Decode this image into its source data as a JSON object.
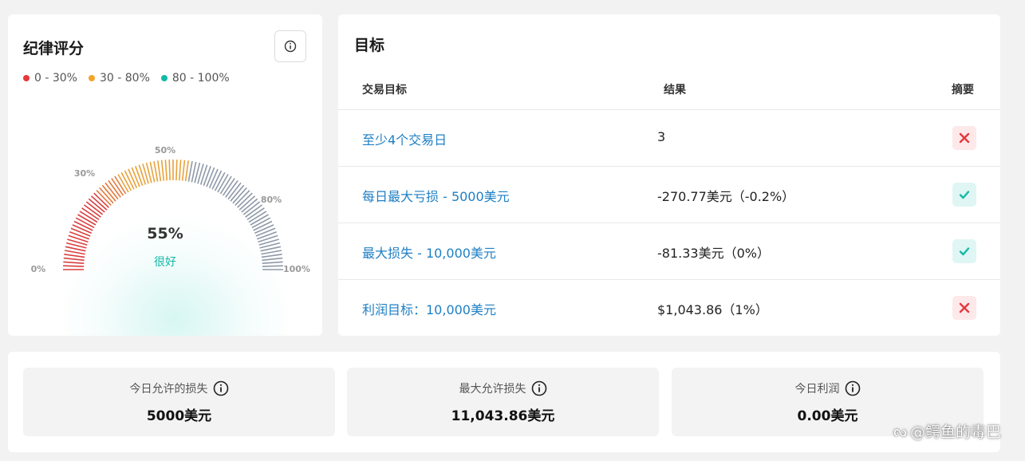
{
  "discipline": {
    "title": "纪律评分",
    "legend": [
      {
        "label": "0 - 30%",
        "color": "#e5383b"
      },
      {
        "label": "30 - 80%",
        "color": "#f4a42a"
      },
      {
        "label": "80 - 100%",
        "color": "#14b8a6"
      }
    ],
    "gauge": {
      "value_percent": 55,
      "value_label": "55%",
      "status": "很好",
      "tick_labels": [
        "0%",
        "30%",
        "50%",
        "80%",
        "100%"
      ],
      "segment_colors": {
        "low": "#d94040",
        "mid": "#e8a23a",
        "rest": "#8e99a8"
      }
    },
    "info_icon": "info-icon"
  },
  "goals": {
    "title": "目标",
    "headers": {
      "goal": "交易目标",
      "result": "结果",
      "summary": "摘要"
    },
    "rows": [
      {
        "goal": "至少4个交易日",
        "result": "3",
        "status": "fail"
      },
      {
        "goal": "每日最大亏损 - 5000美元",
        "result": "-270.77美元（-0.2%）",
        "status": "pass"
      },
      {
        "goal": "最大损失 - 10,000美元",
        "result": "-81.33美元（0%）",
        "status": "pass"
      },
      {
        "goal": "利润目标：10,000美元",
        "result": "$1,043.86（1%）",
        "status": "fail"
      }
    ]
  },
  "stats": [
    {
      "label": "今日允许的损失",
      "value": "5000美元"
    },
    {
      "label": "最大允许损失",
      "value": "11,043.86美元"
    },
    {
      "label": "今日利润",
      "value": "0.00美元"
    }
  ],
  "watermark": "@鳄鱼的毒巴",
  "colors": {
    "link": "#1e7fc4",
    "fail": "#e5383b",
    "pass": "#14b8a6"
  }
}
